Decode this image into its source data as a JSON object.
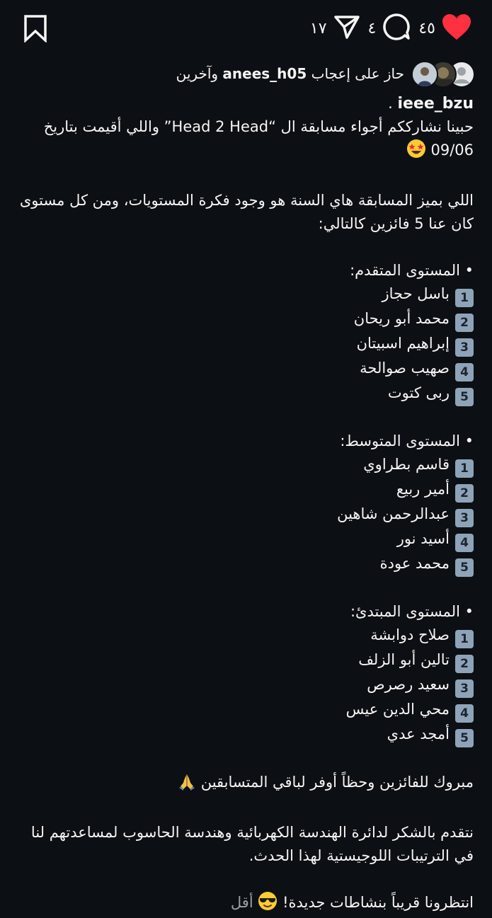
{
  "post": {
    "likes_count": "٤٥",
    "comments_count": "٤",
    "shares_count": "١٧",
    "liked_by_prefix": "حاز على إعجاب",
    "liked_by_user": "anees_h05",
    "liked_by_suffix": "وآخرين",
    "author": "ieee_bzu",
    "author_dot": ".",
    "caption": {
      "intro1": "حبينا نشارككم أجواء مسابقة ال “Head 2 Head” واللي أقيمت بتاريخ",
      "intro2": "09/06",
      "para2_1": "اللي بميز المسابقة هاي السنة هو وجود فكرة المستويات، ومن كل مستوى",
      "para2_2": "كان عنا 5 فائزين كالتالي:",
      "levels": [
        {
          "title": "• المستوى المتقدم:",
          "winners": [
            "باسل حجاز",
            "محمد أبو ريحان",
            "إبراهيم اسبيتان",
            "صهيب صوالحة",
            "ربى كتوت"
          ]
        },
        {
          "title": "• المستوى المتوسط:",
          "winners": [
            "قاسم بطراوي",
            "أمير ربيع",
            "عبدالرحمن شاهين",
            "أسيد نور",
            "محمد عودة"
          ]
        },
        {
          "title": "• المستوى المبتدئ:",
          "winners": [
            "صلاح دوابشة",
            "تالين أبو الزلف",
            "سعيد رصرص",
            "محي الدين عيس",
            "أمجد عدي"
          ]
        }
      ],
      "rank_labels": [
        "1",
        "2",
        "3",
        "4",
        "5"
      ],
      "congrats": "مبروك للفائزين وحظاً أوفر لباقي المتسابقين",
      "thanks1": "نتقدم بالشكر لدائرة الهندسة الكهربائية وهندسة الحاسوب لمساعدتهم لنا",
      "thanks2": "في الترتيبات اللوجيستية لهذا الحدث.",
      "outro": "انتظرونا قريباً بنشاطات جديدة!",
      "less_label": "أقل"
    }
  },
  "icons": {
    "like": "heart-icon",
    "comment": "comment-icon",
    "share": "send-icon",
    "save": "bookmark-icon"
  },
  "colors": {
    "background": "#0c1014",
    "text": "#f5f5f5",
    "heart": "#ff3040",
    "muted": "#9aa0a6",
    "number_badge": "#8fa3b8"
  }
}
